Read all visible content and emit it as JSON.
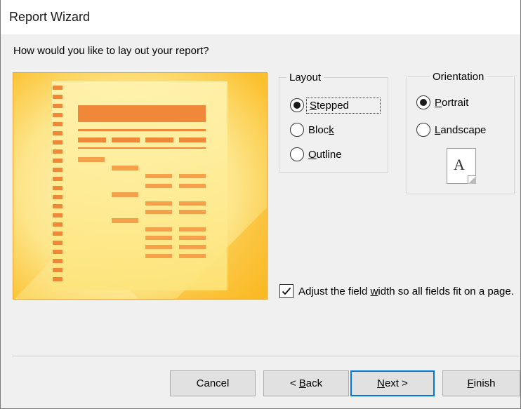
{
  "window": {
    "title": "Report Wizard"
  },
  "question": "How would you like to lay out your report?",
  "layout": {
    "legend": "Layout",
    "options": [
      {
        "label": "Stepped",
        "accel": "S",
        "rest": "tepped",
        "checked": true
      },
      {
        "label": "Block",
        "pre": "Bloc",
        "accel": "k",
        "checked": false
      },
      {
        "label": "Outline",
        "accel": "O",
        "rest": "utline",
        "checked": false
      }
    ]
  },
  "orientation": {
    "legend": "Orientation",
    "options": [
      {
        "label": "Portrait",
        "accel": "P",
        "rest": "ortrait",
        "checked": true
      },
      {
        "label": "Landscape",
        "accel": "L",
        "rest": "andscape",
        "checked": false
      }
    ],
    "icon_letter": "A"
  },
  "adjust": {
    "checked": true,
    "pre": "Adjust the field ",
    "accel": "w",
    "post": "idth so all fields fit on a page."
  },
  "buttons": {
    "cancel": "Cancel",
    "back_pre": "< ",
    "back_accel": "B",
    "back_rest": "ack",
    "next_accel": "N",
    "next_rest": "ext >",
    "finish_accel": "F",
    "finish_rest": "inish"
  },
  "colors": {
    "preview_bg": "#fbc02d",
    "preview_accent": "#f0883a",
    "default_button_border": "#0078d7"
  }
}
